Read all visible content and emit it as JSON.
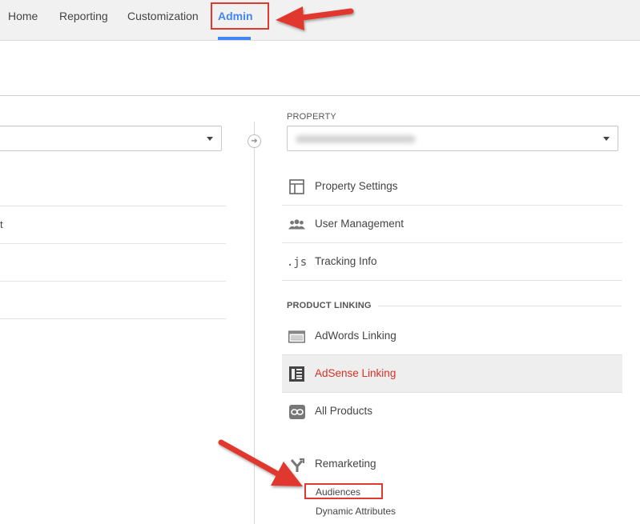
{
  "nav": {
    "tabs": [
      {
        "label": "Home"
      },
      {
        "label": "Reporting"
      },
      {
        "label": "Customization"
      },
      {
        "label": "Admin"
      }
    ],
    "active_tab": "Admin"
  },
  "account_column": {
    "row_text_fragment": "t"
  },
  "property_column": {
    "section_label": "PROPERTY",
    "items": [
      {
        "label": "Property Settings",
        "icon": "property-settings-icon"
      },
      {
        "label": "User Management",
        "icon": "users-icon"
      },
      {
        "label": "Tracking Info",
        "icon": "js-icon",
        "icon_text": ".js"
      }
    ],
    "product_linking_label": "PRODUCT LINKING",
    "linking_items": [
      {
        "label": "AdWords Linking",
        "icon": "adwords-icon"
      },
      {
        "label": "AdSense Linking",
        "icon": "adsense-icon",
        "selected": true
      },
      {
        "label": "All Products",
        "icon": "link-icon"
      }
    ],
    "remarketing": {
      "label": "Remarketing",
      "icon": "remarketing-icon",
      "sub_items": [
        {
          "label": "Audiences"
        },
        {
          "label": "Dynamic Attributes"
        }
      ]
    }
  },
  "colors": {
    "accent": "#4285f4",
    "annotation_red": "#e0392f",
    "selected_text": "#d93025"
  }
}
